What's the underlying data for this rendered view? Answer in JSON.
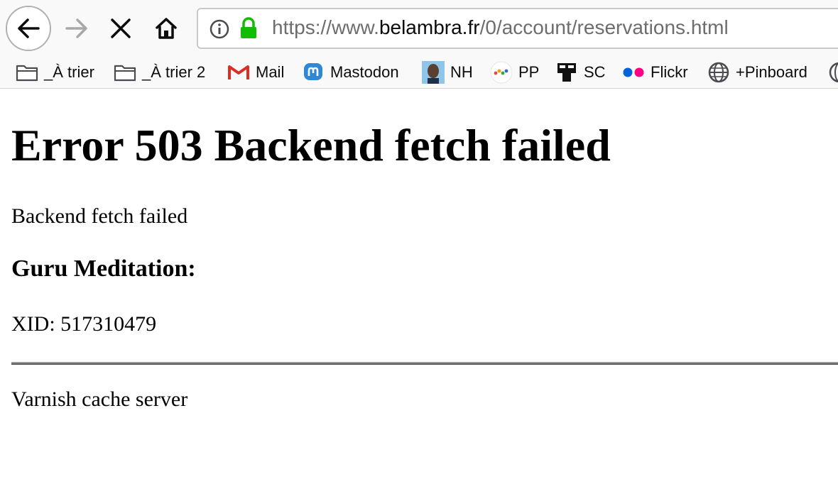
{
  "url": {
    "prefix": "https://www.",
    "domain": "belambra.fr",
    "path": "/0/account/reservations.html"
  },
  "bookmarks": [
    {
      "label": "_À trier",
      "icon": "folder-icon"
    },
    {
      "label": "_À trier 2",
      "icon": "folder-icon"
    },
    {
      "label": "Mail",
      "icon": "gmail-icon"
    },
    {
      "label": "Mastodon",
      "icon": "mastodon-icon"
    },
    {
      "label": "NH",
      "icon": "avatar-icon"
    },
    {
      "label": "PP",
      "icon": "pp-icon"
    },
    {
      "label": "SC",
      "icon": "sc-icon"
    },
    {
      "label": "Flickr",
      "icon": "flickr-icon"
    },
    {
      "label": "+Pinboard",
      "icon": "globe-icon"
    }
  ],
  "page": {
    "title": "Error 503 Backend fetch failed",
    "message": "Backend fetch failed",
    "guru_heading": "Guru Meditation:",
    "xid": "XID: 517310479",
    "footer": "Varnish cache server"
  },
  "colors": {
    "lock_green": "#12bc00",
    "gmail_red": "#d93025",
    "mastodon_blue": "#3088d4",
    "flickr_blue": "#0063dc",
    "flickr_pink": "#ff0084"
  }
}
